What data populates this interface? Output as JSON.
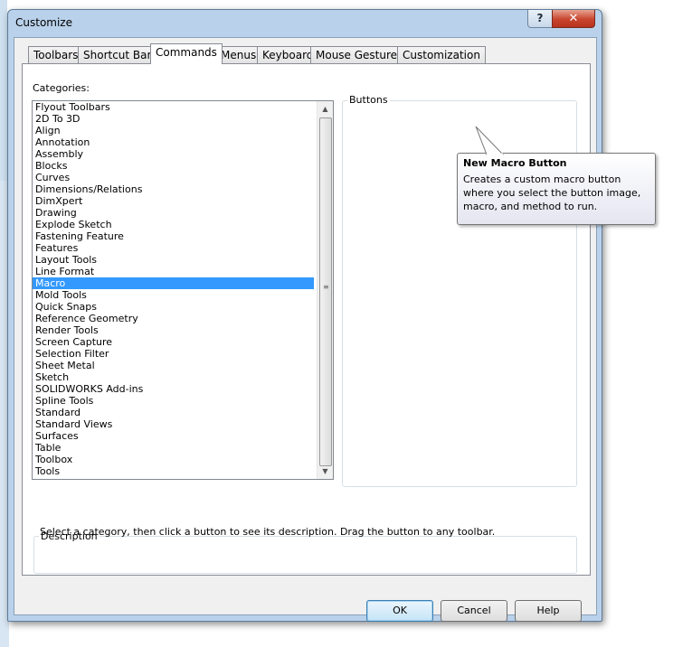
{
  "window": {
    "title": "Customize",
    "help": "?",
    "close": "✕"
  },
  "tabs": [
    {
      "label": "Toolbars",
      "active": false
    },
    {
      "label": "Shortcut Bars",
      "active": false
    },
    {
      "label": "Commands",
      "active": true
    },
    {
      "label": "Menus",
      "active": false
    },
    {
      "label": "Keyboard",
      "active": false
    },
    {
      "label": "Mouse Gestures",
      "active": false
    },
    {
      "label": "Customization",
      "active": false
    }
  ],
  "categories": {
    "label": "Categories:",
    "selected": "Macro",
    "items": [
      "Flyout Toolbars",
      "2D To 3D",
      "Align",
      "Annotation",
      "Assembly",
      "Blocks",
      "Curves",
      "Dimensions/Relations",
      "DimXpert",
      "Drawing",
      "Explode Sketch",
      "Fastening Feature",
      "Features",
      "Layout Tools",
      "Line Format",
      "Macro",
      "Mold Tools",
      "Quick Snaps",
      "Reference Geometry",
      "Render Tools",
      "Screen Capture",
      "Selection Filter",
      "Sheet Metal",
      "Sketch",
      "SOLIDWORKS Add-ins",
      "Spline Tools",
      "Standard",
      "Standard Views",
      "Surfaces",
      "Table",
      "Toolbox",
      "Tools"
    ]
  },
  "buttons_group": {
    "label": "Buttons",
    "icons": [
      {
        "name": "run-macro-icon",
        "color": "#2fb52f"
      },
      {
        "name": "stop-macro-icon",
        "color": "#1a1a1a"
      },
      {
        "name": "record-pause-macro-icon",
        "color": "#e02020"
      },
      {
        "name": "new-macro-icon",
        "color": "#d9a520"
      },
      {
        "name": "edit-macro-icon",
        "color": "#3a6fb8"
      },
      {
        "name": "new-macro-button-icon",
        "color": "#e6b020"
      }
    ]
  },
  "tooltip": {
    "title": "New Macro Button",
    "body": "Creates a custom macro button where you select the button image, macro, and method to run."
  },
  "hint": "Select a category, then click a button to see its description. Drag the button to any toolbar.",
  "description_group": {
    "label": "Description",
    "text": ""
  },
  "footer": {
    "ok": "OK",
    "cancel": "Cancel",
    "help": "Help"
  },
  "colors": {
    "selection": "#3399ff",
    "frame": "#b9d1ea",
    "close": "#c8452f"
  }
}
